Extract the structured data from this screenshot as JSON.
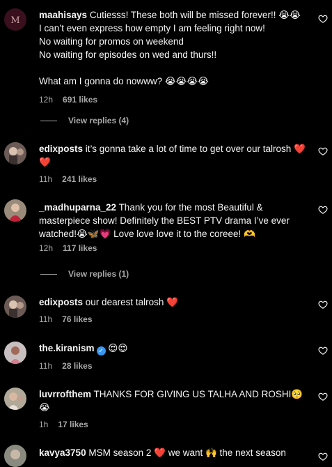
{
  "comments": [
    {
      "username": "maahisays",
      "text": "Cutiesss! These both will be missed forever!! 😭😭\nI can’t even express how empty I am feeling right now!\nNo waiting for promos on weekend\nNo waiting for episodes on wed and thurs!!\n\nWhat am I gonna do nowww? 😭😭😭😭",
      "time": "12h",
      "likes": "691 likes",
      "replies": "View replies (4)"
    },
    {
      "username": "edixposts",
      "text": "it’s gonna take a lot of time to get over our talrosh ❤️❤️",
      "time": "11h",
      "likes": "241 likes"
    },
    {
      "username": "_madhuparna_22",
      "text": "Thank you for the most Beautiful & masterpiece show! Definitely the BEST PTV drama I’ve ever watched!😭🦋💗 Love love love it to the coreee! 🫶",
      "time": "12h",
      "likes": "117 likes",
      "replies": "View replies (1)"
    },
    {
      "username": "edixposts",
      "text": "our dearest talrosh ❤️",
      "time": "11h",
      "likes": "76 likes"
    },
    {
      "username": "the.kiranism",
      "text": "😍😍",
      "time": "11h",
      "likes": "28 likes"
    },
    {
      "username": "luvrrofthem",
      "text": "THANKS FOR GIVING US TALHA AND ROSHI🥺😭",
      "time": "1h",
      "likes": "17 likes"
    },
    {
      "username": "kavya3750",
      "text": "MSM season 2 ❤️ we want 🙌 the next season"
    }
  ],
  "icons": {
    "like": "heart-outline-icon",
    "verified": "verified-badge-icon"
  },
  "colors": {
    "background": "#000000",
    "secondary_text": "#a8a8a8",
    "verified": "#3897f0"
  }
}
